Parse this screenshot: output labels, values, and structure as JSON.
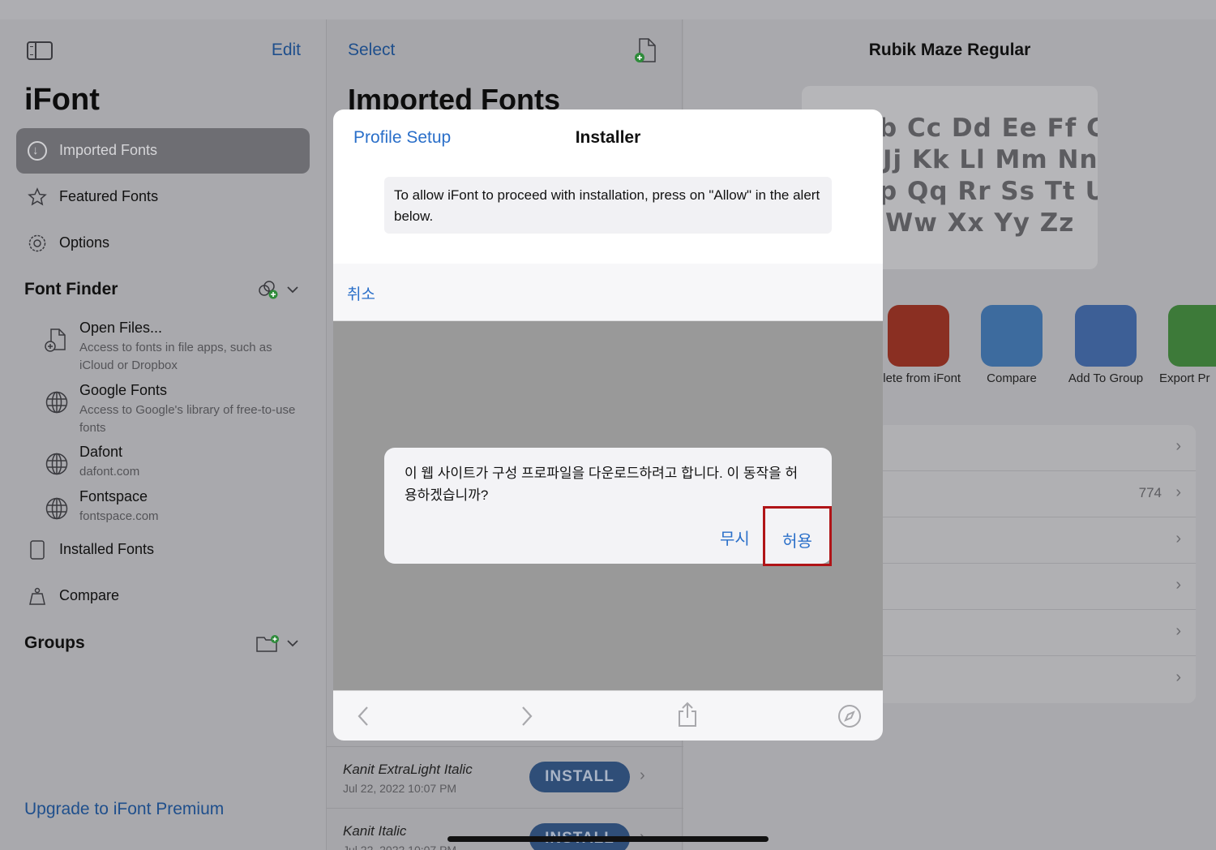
{
  "sidebar": {
    "edit_label": "Edit",
    "app_title": "iFont",
    "nav": [
      {
        "label": "Imported Fonts",
        "icon": "download-circle-icon",
        "active": true
      },
      {
        "label": "Featured Fonts",
        "icon": "star-icon"
      },
      {
        "label": "Options",
        "icon": "gear-icon"
      }
    ],
    "font_finder": {
      "title": "Font Finder",
      "items": [
        {
          "title": "Open Files...",
          "subtitle": "Access to fonts in file apps, such as iCloud or Dropbox",
          "icon": "doc-add-icon"
        },
        {
          "title": "Google Fonts",
          "subtitle": "Access to Google's library of free-to-use fonts",
          "icon": "globe-icon"
        },
        {
          "title": "Dafont",
          "subtitle": "dafont.com",
          "icon": "globe-icon"
        },
        {
          "title": "Fontspace",
          "subtitle": "fontspace.com",
          "icon": "globe-icon"
        }
      ]
    },
    "nav2": [
      {
        "label": "Installed Fonts",
        "icon": "tablet-icon"
      },
      {
        "label": "Compare",
        "icon": "weight-icon"
      }
    ],
    "groups_title": "Groups",
    "upgrade_label": "Upgrade to iFont Premium"
  },
  "middle": {
    "select_label": "Select",
    "title": "Imported Fonts",
    "rows": [
      {
        "name": "Kanit ExtraLight Italic",
        "date": "Jul 22, 2022 10:07 PM",
        "button": "INSTALL"
      },
      {
        "name": "Kanit Italic",
        "date": "Jul 22, 2022 10:07 PM",
        "button": "INSTALL"
      }
    ]
  },
  "detail": {
    "title": "Rubik Maze Regular",
    "preview_lines": [
      "b Cc Dd Ee Ff Gg",
      "Jj Kk Ll Mm Nn",
      "p Qq Rr Ss Tt Uu",
      "Ww Xx Yy Zz"
    ],
    "actions": [
      {
        "label": "elete from iFont",
        "color": "#8a2f22"
      },
      {
        "label": "Compare",
        "color": "#3d6b9e"
      },
      {
        "label": "Add To Group",
        "color": "#3d5f96"
      },
      {
        "label": "Export Pr",
        "color": "#3d7a39"
      }
    ],
    "list_rows": [
      {
        "value": ""
      },
      {
        "value": "774"
      },
      {
        "value": ""
      },
      {
        "value": ""
      },
      {
        "value": ""
      },
      {
        "value": ""
      }
    ]
  },
  "modal": {
    "back_label": "Profile Setup",
    "title": "Installer",
    "note": "To allow iFont to proceed with installation, press on \"Allow\" in the alert below.",
    "cancel_label": "취소"
  },
  "alert": {
    "message": "이 웹 사이트가 구성 프로파일을 다운로드하려고 합니다. 이 동작을 허용하겠습니까?",
    "ignore_label": "무시",
    "allow_label": "허용",
    "highlight_color": "#b01417"
  }
}
